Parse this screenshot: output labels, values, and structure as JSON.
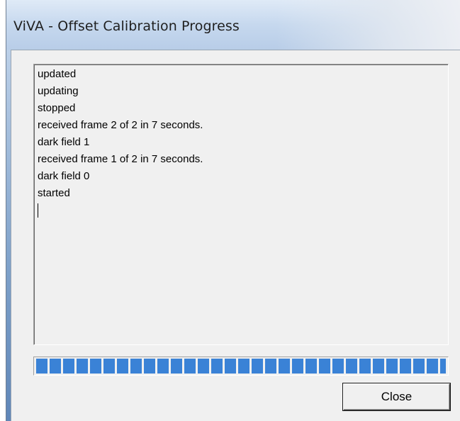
{
  "window": {
    "title": "ViVA - Offset Calibration Progress"
  },
  "log": {
    "lines": [
      "updated",
      "updating",
      "stopped",
      "received frame 2 of 2 in 7 seconds.",
      "dark field 1",
      "received frame 1 of 2 in 7 seconds.",
      "dark field 0",
      "started"
    ]
  },
  "progress": {
    "percent": 100,
    "color": "#3a82d6"
  },
  "buttons": {
    "close_label": "Close"
  }
}
